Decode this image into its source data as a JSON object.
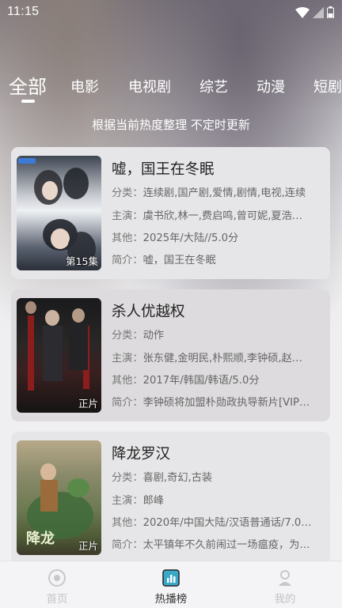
{
  "status_bar": {
    "time": "11:15"
  },
  "tabs": [
    {
      "label": "全部",
      "active": true
    },
    {
      "label": "电影"
    },
    {
      "label": "电视剧"
    },
    {
      "label": "综艺"
    },
    {
      "label": "动漫"
    },
    {
      "label": "短剧"
    }
  ],
  "subtitle": "根据当前热度整理 不定时更新",
  "cards": [
    {
      "title": "嘘，国王在冬眠",
      "badge": "第15集",
      "category_label": "分类：",
      "category": "连续剧,国产剧,爱情,剧情,电视,连续",
      "cast_label": "主演：",
      "cast": "虞书欣,林一,费启鸣,曾可妮,夏浩…",
      "other_label": "其他：",
      "other": "2025年/大陆//5.0分",
      "intro_label": "简介：",
      "intro": "嘘，国王在冬眠"
    },
    {
      "title": "杀人优越权",
      "badge": "正片",
      "category_label": "分类：",
      "category": "动作",
      "cast_label": "主演：",
      "cast": "张东健,金明民,朴熙顺,李钟硕,赵…",
      "other_label": "其他：",
      "other": "2017年/韩国/韩语/5.0分",
      "intro_label": "简介：",
      "intro": "李钟硕将加盟朴勋政执导新片[VIP…"
    },
    {
      "title": "降龙罗汉",
      "badge": "正片",
      "category_label": "分类：",
      "category": "喜剧,奇幻,古装",
      "cast_label": "主演：",
      "cast": "郎峰",
      "other_label": "其他：",
      "other": "2020年/中国大陆/汉语普通话/7.0…",
      "intro_label": "简介：",
      "intro": "太平镇年不久前闹过一场瘟疫，为…"
    }
  ],
  "bottom_nav": [
    {
      "label": "首页",
      "icon": "home-icon"
    },
    {
      "label": "热播榜",
      "icon": "hot-list-icon",
      "active": true
    },
    {
      "label": "我的",
      "icon": "profile-icon"
    }
  ],
  "colors": {
    "accent_active_nav": "#3aa9c8",
    "text_primary": "#222222",
    "text_secondary": "#666666"
  }
}
